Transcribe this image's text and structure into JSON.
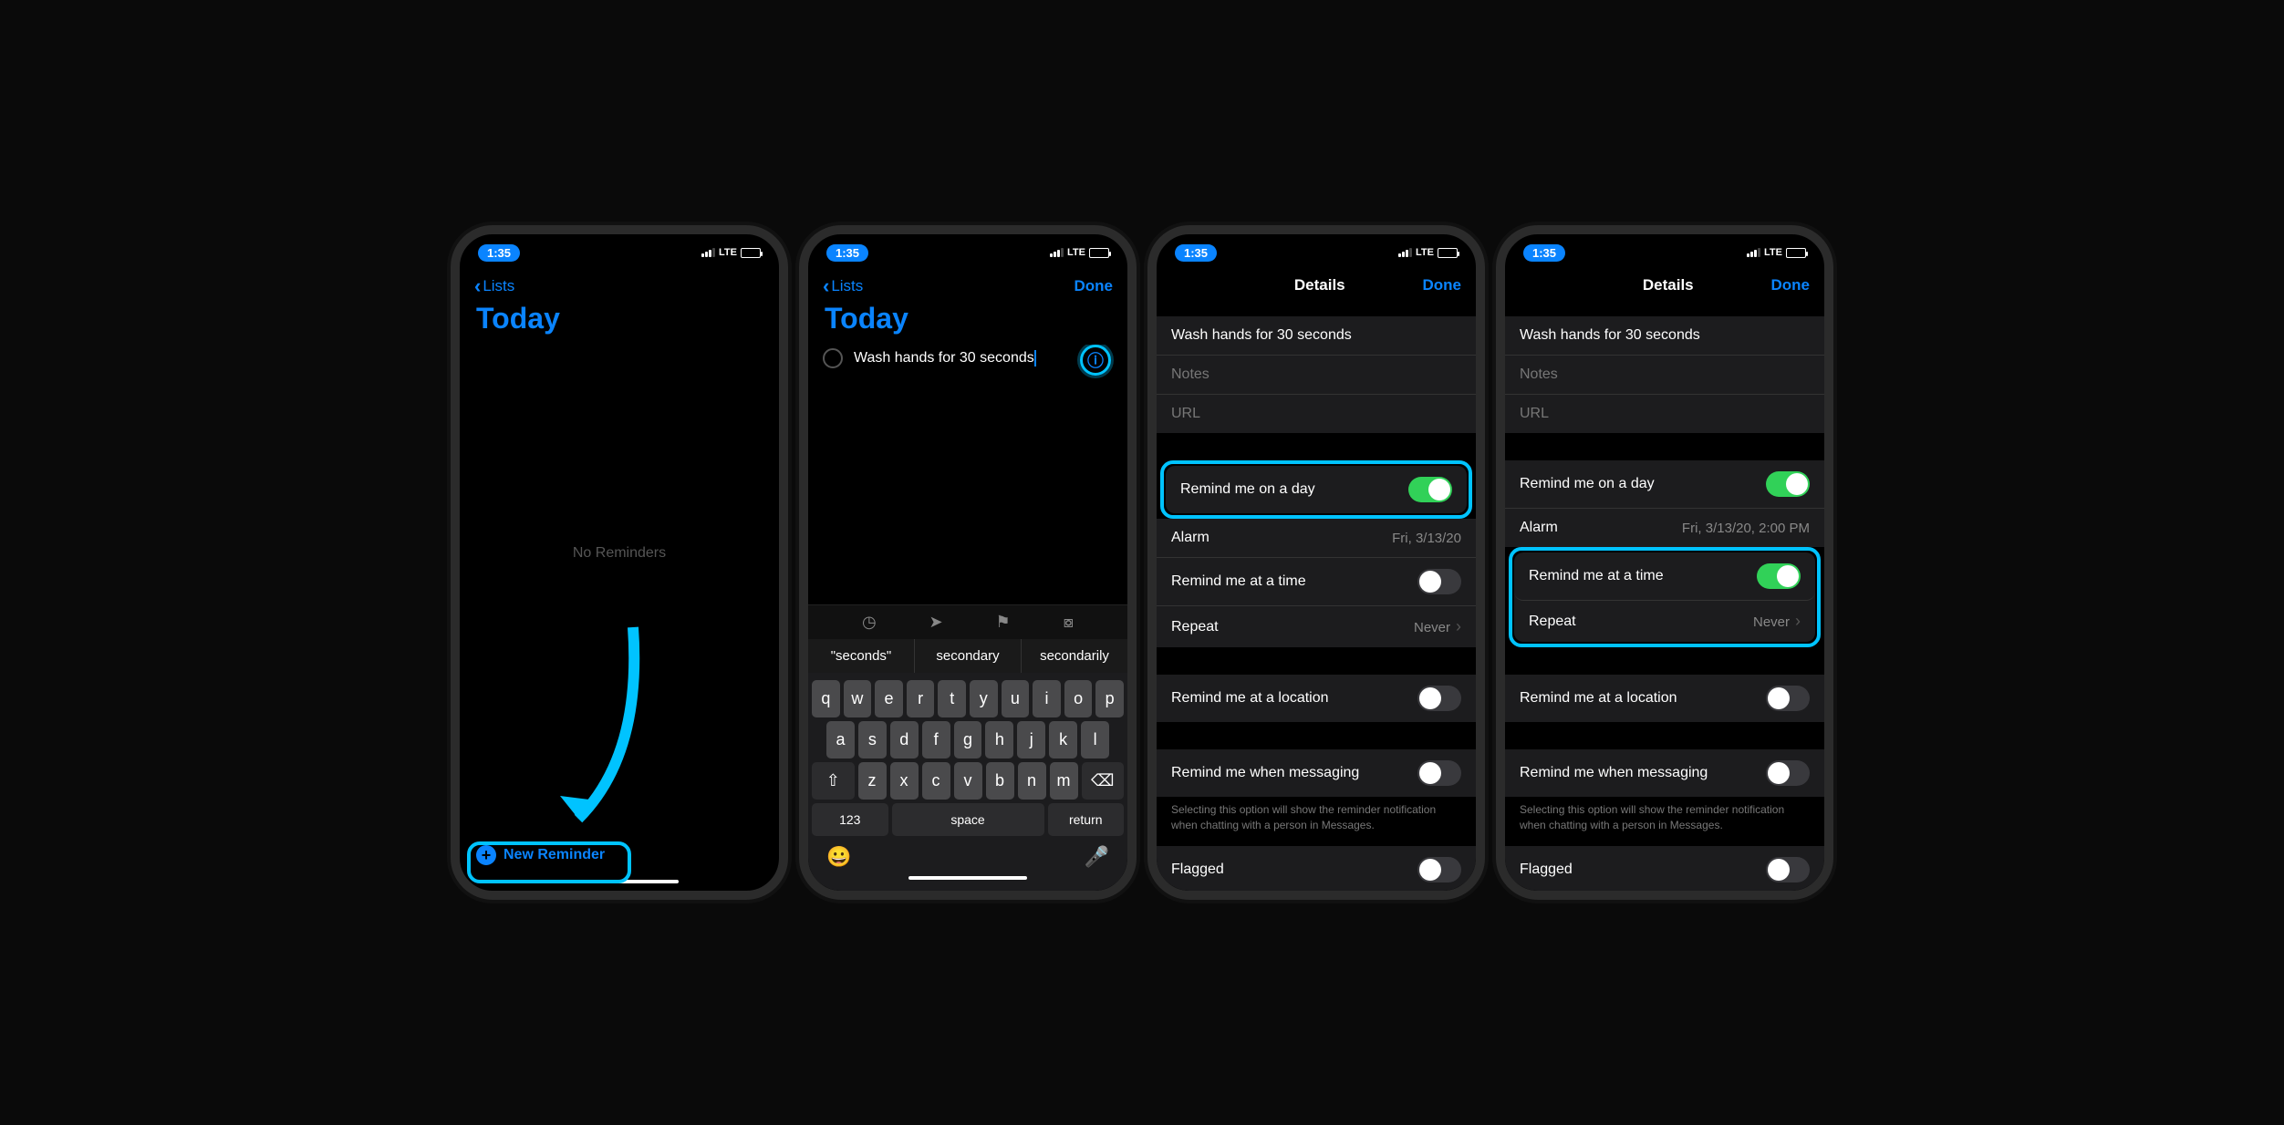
{
  "status": {
    "time": "1:35",
    "carrier": "LTE"
  },
  "nav": {
    "back": "Lists",
    "done": "Done",
    "details_title": "Details"
  },
  "screen1": {
    "title": "Today",
    "empty": "No Reminders",
    "new_btn": "New Reminder"
  },
  "screen2": {
    "title": "Today",
    "reminder_text": "Wash hands for 30 seconds",
    "kb_suggestions": [
      "\"seconds\"",
      "secondary",
      "secondarily"
    ],
    "kb_rows": {
      "r1": [
        "q",
        "w",
        "e",
        "r",
        "t",
        "y",
        "u",
        "i",
        "o",
        "p"
      ],
      "r2": [
        "a",
        "s",
        "d",
        "f",
        "g",
        "h",
        "j",
        "k",
        "l"
      ],
      "r3_mid": [
        "z",
        "x",
        "c",
        "v",
        "b",
        "n",
        "m"
      ]
    },
    "kb_labels": {
      "num": "123",
      "space": "space",
      "return": "return"
    }
  },
  "details3": {
    "title_val": "Wash hands for 30 seconds",
    "notes": "Notes",
    "url": "URL",
    "remind_day": "Remind me on a day",
    "alarm": "Alarm",
    "alarm_val": "Fri, 3/13/20",
    "remind_time": "Remind me at a time",
    "repeat": "Repeat",
    "repeat_val": "Never",
    "remind_loc": "Remind me at a location",
    "remind_msg": "Remind me when messaging",
    "footnote": "Selecting this option will show the reminder notification when chatting with a person in Messages.",
    "flagged": "Flagged"
  },
  "details4": {
    "alarm_val": "Fri, 3/13/20, 2:00 PM"
  }
}
